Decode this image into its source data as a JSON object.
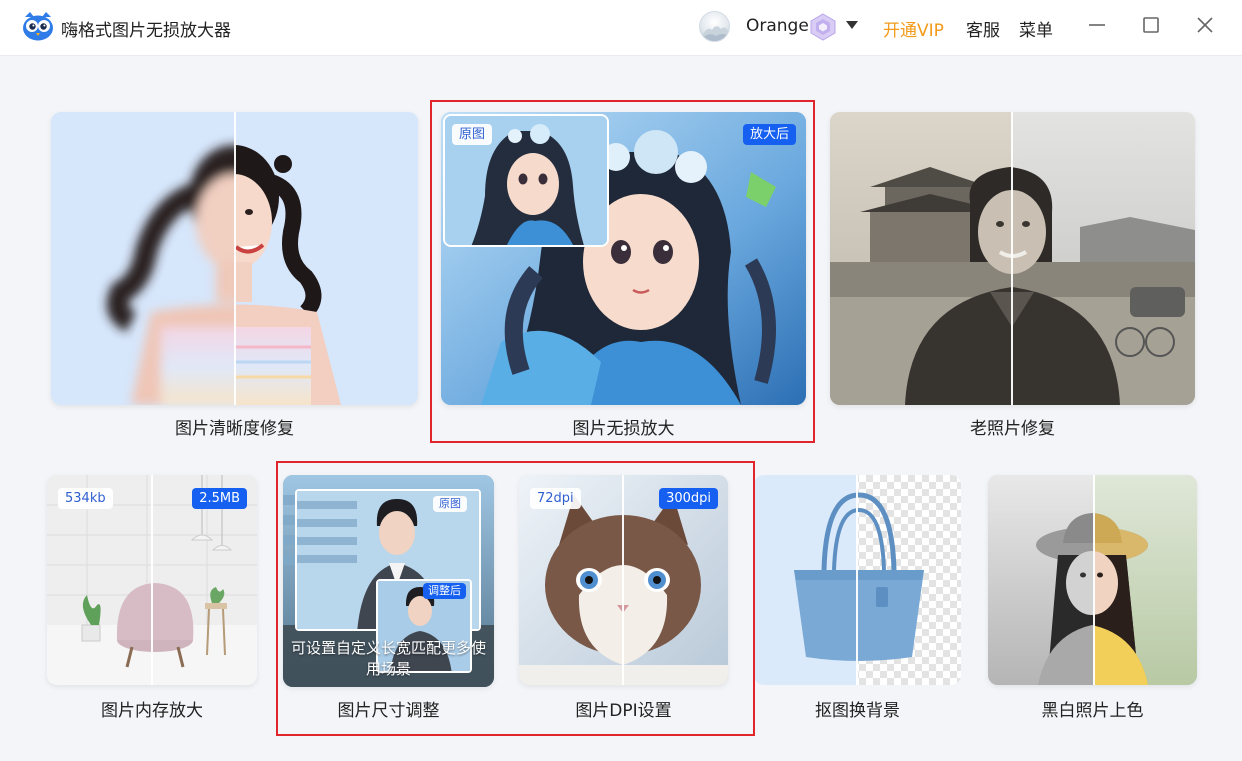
{
  "app": {
    "title": "嗨格式图片无损放大器",
    "username": "Orange",
    "open_vip": "开通VIP",
    "service": "客服",
    "menu": "菜单"
  },
  "colors": {
    "vip_orange": "#f29b1a",
    "accent_blue": "#1560f0",
    "highlight_red": "#e0262b"
  },
  "cards": {
    "clarity": {
      "label": "图片清晰度修复"
    },
    "upscale": {
      "label": "图片无损放大",
      "tag_before": "原图",
      "tag_after": "放大后"
    },
    "old_photo": {
      "label": "老照片修复"
    },
    "size": {
      "label": "图片内存放大",
      "tag_before": "534kb",
      "tag_after": "2.5MB"
    },
    "resize": {
      "label": "图片尺寸调整",
      "tag_before": "原图",
      "tag_after": "调整后",
      "caption": "可设置自定义长宽匹配更多使用场景"
    },
    "dpi": {
      "label": "图片DPI设置",
      "tag_before": "72dpi",
      "tag_after": "300dpi"
    },
    "cutout": {
      "label": "抠图换背景"
    },
    "colorize": {
      "label": "黑白照片上色"
    }
  },
  "icons": {
    "logo": "owl-logo-icon",
    "vip": "vip-crystal-icon",
    "minimize": "minimize-icon",
    "maximize": "maximize-icon",
    "close": "close-icon",
    "dropdown": "chevron-down-icon"
  }
}
